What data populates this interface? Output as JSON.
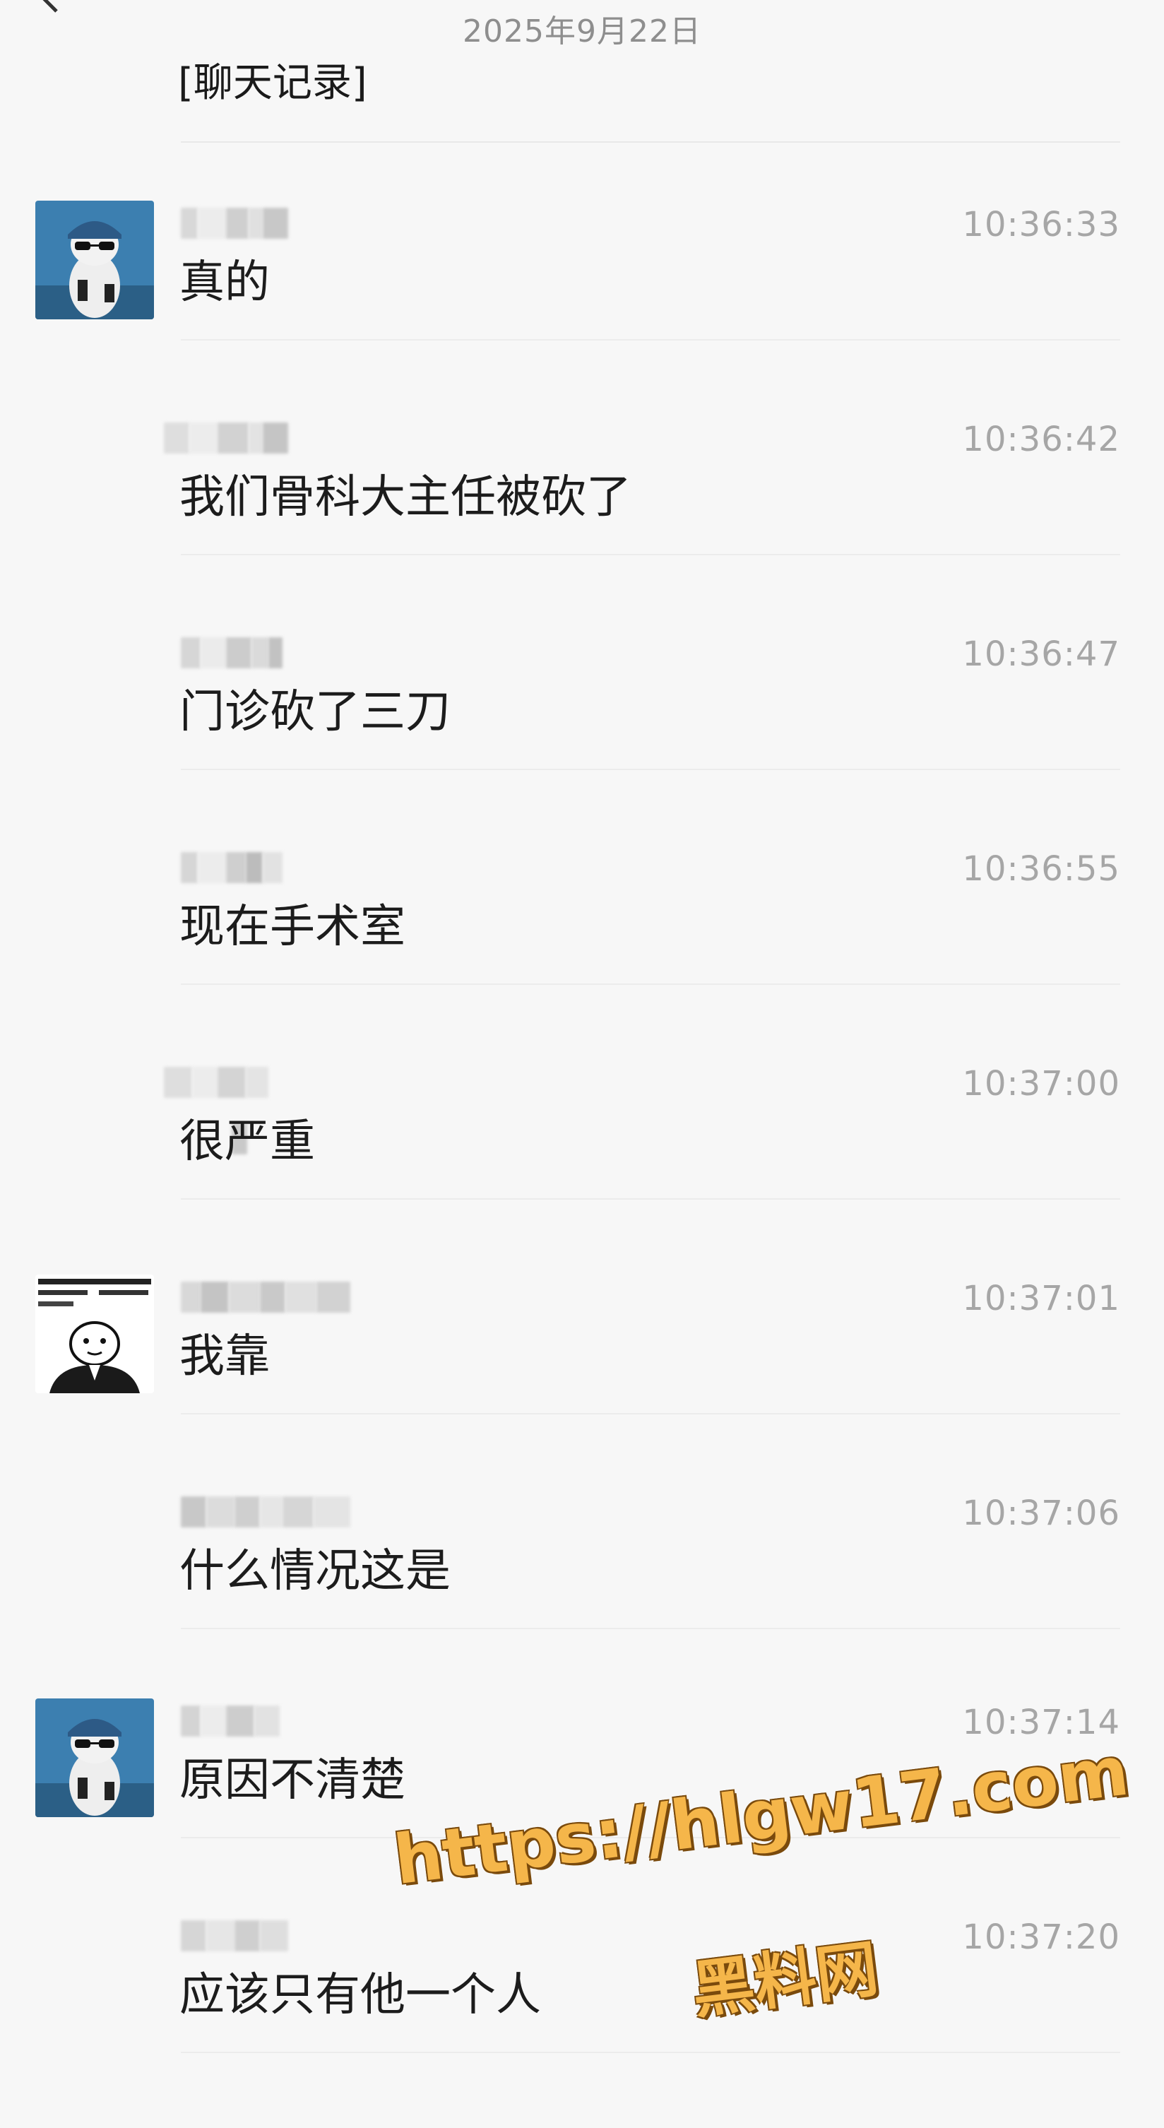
{
  "header": {
    "date": "2025年9月22日",
    "title": "[聊天记录]",
    "back_icon": "back-arrow-icon"
  },
  "messages": [
    {
      "time": "10:36:33",
      "text": "真的",
      "avatar": "cat-sunglasses-avatar",
      "sender_blurred": true
    },
    {
      "time": "10:36:42",
      "text": "我们骨科大主任被砍了",
      "avatar": null,
      "sender_blurred": true
    },
    {
      "time": "10:36:47",
      "text": "门诊砍了三刀",
      "avatar": null,
      "sender_blurred": true
    },
    {
      "time": "10:36:55",
      "text": "现在手术室",
      "avatar": null,
      "sender_blurred": true
    },
    {
      "time": "10:37:00",
      "text": "很严重",
      "avatar": null,
      "sender_blurred": true
    },
    {
      "time": "10:37:01",
      "text": "我靠",
      "avatar": "cartoon-meme-avatar",
      "sender_blurred": true
    },
    {
      "time": "10:37:06",
      "text": "什么情况这是",
      "avatar": null,
      "sender_blurred": true
    },
    {
      "time": "10:37:14",
      "text": "原因不清楚",
      "avatar": "cat-sunglasses-avatar",
      "sender_blurred": true
    },
    {
      "time": "10:37:20",
      "text": "应该只有他一个人",
      "avatar": null,
      "sender_blurred": true
    }
  ],
  "watermark": {
    "url": "https://hlgw17.com",
    "name": "黑料网",
    "color": "#f5b64a",
    "outline_color": "#7a4a0c"
  },
  "colors": {
    "background": "#f7f7f7",
    "text": "#1c1c1c",
    "time": "#a6a6a6",
    "date": "#8e8e8e",
    "divider": "#ececec"
  }
}
